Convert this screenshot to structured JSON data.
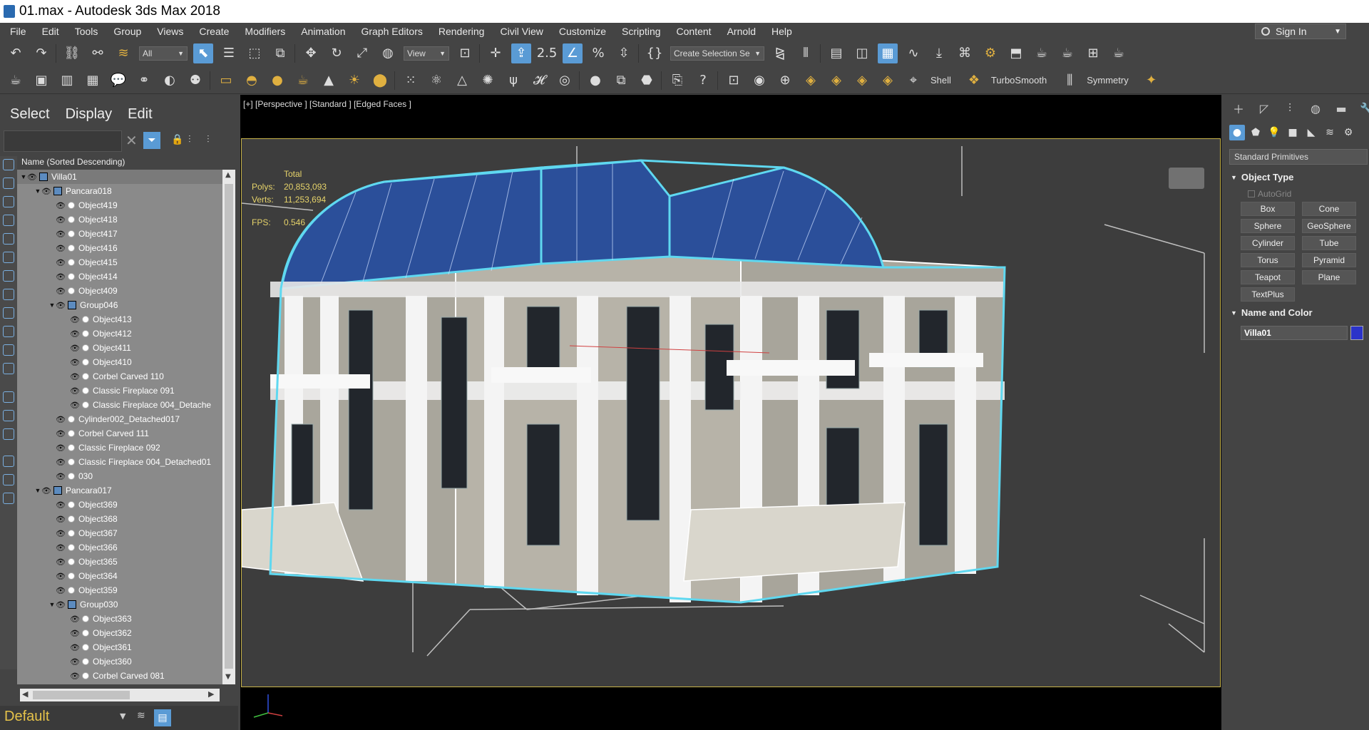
{
  "window": {
    "title": "01.max - Autodesk 3ds Max 2018"
  },
  "menu": [
    "File",
    "Edit",
    "Tools",
    "Group",
    "Views",
    "Create",
    "Modifiers",
    "Animation",
    "Graph Editors",
    "Rendering",
    "Civil View",
    "Customize",
    "Scripting",
    "Content",
    "Arnold",
    "Help"
  ],
  "signin": {
    "label": "Sign In"
  },
  "toolbar1": {
    "filter_dropdown": "All",
    "view_dropdown": "View",
    "snap_angle": "2.5",
    "selection_set": "Create Selection Se"
  },
  "toolbar2": {
    "shell_label": "Shell",
    "turbosmooth_label": "TurboSmooth",
    "symmetry_label": "Symmetry"
  },
  "explorer": {
    "tabs": [
      "Select",
      "Display",
      "Edit"
    ],
    "column_header": "Name (Sorted Descending)",
    "rows": [
      {
        "label": "Villa01",
        "level": 0,
        "type": "group",
        "expanded": true
      },
      {
        "label": "Pancara018",
        "level": 1,
        "type": "group",
        "expanded": true
      },
      {
        "label": "Object419",
        "level": 2,
        "type": "obj"
      },
      {
        "label": "Object418",
        "level": 2,
        "type": "obj"
      },
      {
        "label": "Object417",
        "level": 2,
        "type": "obj"
      },
      {
        "label": "Object416",
        "level": 2,
        "type": "obj"
      },
      {
        "label": "Object415",
        "level": 2,
        "type": "obj"
      },
      {
        "label": "Object414",
        "level": 2,
        "type": "obj"
      },
      {
        "label": "Object409",
        "level": 2,
        "type": "obj"
      },
      {
        "label": "Group046",
        "level": 2,
        "type": "group",
        "expanded": true
      },
      {
        "label": "Object413",
        "level": 3,
        "type": "obj"
      },
      {
        "label": "Object412",
        "level": 3,
        "type": "obj"
      },
      {
        "label": "Object411",
        "level": 3,
        "type": "obj"
      },
      {
        "label": "Object410",
        "level": 3,
        "type": "obj"
      },
      {
        "label": "Corbel Carved 110",
        "level": 3,
        "type": "obj"
      },
      {
        "label": "Classic Fireplace 091",
        "level": 3,
        "type": "obj"
      },
      {
        "label": "Classic Fireplace 004_Detache",
        "level": 3,
        "type": "obj"
      },
      {
        "label": "Cylinder002_Detached017",
        "level": 2,
        "type": "obj"
      },
      {
        "label": "Corbel Carved 111",
        "level": 2,
        "type": "obj"
      },
      {
        "label": "Classic Fireplace 092",
        "level": 2,
        "type": "obj"
      },
      {
        "label": "Classic Fireplace 004_Detached01",
        "level": 2,
        "type": "obj"
      },
      {
        "label": "030",
        "level": 2,
        "type": "obj"
      },
      {
        "label": "Pancara017",
        "level": 1,
        "type": "group",
        "expanded": true
      },
      {
        "label": "Object369",
        "level": 2,
        "type": "obj"
      },
      {
        "label": "Object368",
        "level": 2,
        "type": "obj"
      },
      {
        "label": "Object367",
        "level": 2,
        "type": "obj"
      },
      {
        "label": "Object366",
        "level": 2,
        "type": "obj"
      },
      {
        "label": "Object365",
        "level": 2,
        "type": "obj"
      },
      {
        "label": "Object364",
        "level": 2,
        "type": "obj"
      },
      {
        "label": "Object359",
        "level": 2,
        "type": "obj"
      },
      {
        "label": "Group030",
        "level": 2,
        "type": "group",
        "expanded": true
      },
      {
        "label": "Object363",
        "level": 3,
        "type": "obj"
      },
      {
        "label": "Object362",
        "level": 3,
        "type": "obj"
      },
      {
        "label": "Object361",
        "level": 3,
        "type": "obj"
      },
      {
        "label": "Object360",
        "level": 3,
        "type": "obj"
      },
      {
        "label": "Corbel Carved 081",
        "level": 3,
        "type": "obj"
      }
    ],
    "layer": "Default"
  },
  "viewport": {
    "label": "[+] [Perspective ] [Standard ] [Edged Faces ]",
    "stats_header": "Total",
    "polys_label": "Polys:",
    "polys_value": "20,853,093",
    "verts_label": "Verts:",
    "verts_value": "11,253,694",
    "fps_label": "FPS:",
    "fps_value": "0.546"
  },
  "command_panel": {
    "category": "Standard Primitives",
    "object_type_title": "Object Type",
    "autogrid_label": "AutoGrid",
    "buttons": [
      "Box",
      "Cone",
      "Sphere",
      "GeoSphere",
      "Cylinder",
      "Tube",
      "Torus",
      "Pyramid",
      "Teapot",
      "Plane",
      "TextPlus"
    ],
    "name_color_title": "Name and Color",
    "name_value": "Villa01",
    "color": "#2b33c9"
  },
  "colors": {
    "accent": "#5a9bd5",
    "stats_text": "#e6d36a",
    "selection_outline": "#5fd8f0",
    "roof_glass": "#2b4f9a"
  }
}
